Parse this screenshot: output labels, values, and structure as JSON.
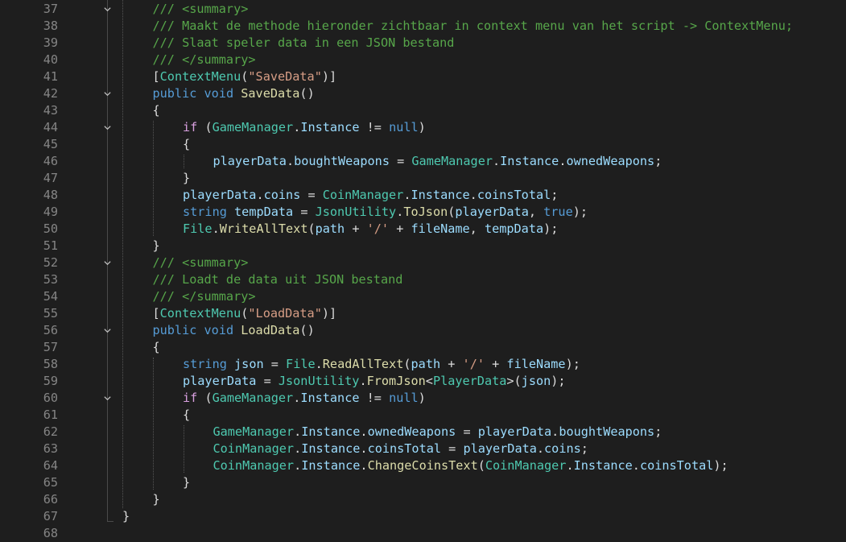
{
  "editor": {
    "fold_icon": "chevron-down-icon",
    "colors": {
      "background": "#1e1e1e",
      "line_number": "#858585",
      "comment": "#57a64a",
      "keyword": "#569cd6",
      "control": "#d8a0df",
      "method": "#dcdcaa",
      "type": "#4ec9b0",
      "string": "#d69d85",
      "variable": "#9cdcfe",
      "text": "#dcdcdc"
    },
    "lines": [
      {
        "n": "37",
        "fold": true,
        "indent": 1,
        "tokens": [
          [
            "comment",
            "/// <summary>"
          ]
        ]
      },
      {
        "n": "38",
        "fold": false,
        "indent": 1,
        "tokens": [
          [
            "comment",
            "/// Maakt de methode hieronder zichtbaar in context menu van het script -> ContextMenu;"
          ]
        ]
      },
      {
        "n": "39",
        "fold": false,
        "indent": 1,
        "tokens": [
          [
            "comment",
            "/// Slaat speler data in een JSON bestand"
          ]
        ]
      },
      {
        "n": "40",
        "fold": false,
        "indent": 1,
        "tokens": [
          [
            "comment",
            "/// </summary>"
          ]
        ]
      },
      {
        "n": "41",
        "fold": false,
        "indent": 1,
        "tokens": [
          [
            "plain",
            "["
          ],
          [
            "type",
            "ContextMenu"
          ],
          [
            "plain",
            "("
          ],
          [
            "string",
            "\"SaveData\""
          ],
          [
            "plain",
            ")]"
          ]
        ]
      },
      {
        "n": "42",
        "fold": true,
        "indent": 1,
        "tokens": [
          [
            "keyword",
            "public"
          ],
          [
            "plain",
            " "
          ],
          [
            "keyword",
            "void"
          ],
          [
            "plain",
            " "
          ],
          [
            "method",
            "SaveData"
          ],
          [
            "plain",
            "()"
          ]
        ]
      },
      {
        "n": "43",
        "fold": false,
        "indent": 1,
        "tokens": [
          [
            "plain",
            "{"
          ]
        ]
      },
      {
        "n": "44",
        "fold": true,
        "indent": 2,
        "tokens": [
          [
            "control",
            "if"
          ],
          [
            "plain",
            " ("
          ],
          [
            "type",
            "GameManager"
          ],
          [
            "plain",
            "."
          ],
          [
            "var",
            "Instance"
          ],
          [
            "plain",
            " != "
          ],
          [
            "keyword",
            "null"
          ],
          [
            "plain",
            ")"
          ]
        ]
      },
      {
        "n": "45",
        "fold": false,
        "indent": 2,
        "tokens": [
          [
            "plain",
            "{"
          ]
        ]
      },
      {
        "n": "46",
        "fold": false,
        "indent": 3,
        "tokens": [
          [
            "var",
            "playerData"
          ],
          [
            "plain",
            "."
          ],
          [
            "var",
            "boughtWeapons"
          ],
          [
            "plain",
            " = "
          ],
          [
            "type",
            "GameManager"
          ],
          [
            "plain",
            "."
          ],
          [
            "var",
            "Instance"
          ],
          [
            "plain",
            "."
          ],
          [
            "var",
            "ownedWeapons"
          ],
          [
            "plain",
            ";"
          ]
        ]
      },
      {
        "n": "47",
        "fold": false,
        "indent": 2,
        "tokens": [
          [
            "plain",
            "}"
          ]
        ]
      },
      {
        "n": "48",
        "fold": false,
        "indent": 2,
        "tokens": [
          [
            "var",
            "playerData"
          ],
          [
            "plain",
            "."
          ],
          [
            "var",
            "coins"
          ],
          [
            "plain",
            " = "
          ],
          [
            "type",
            "CoinManager"
          ],
          [
            "plain",
            "."
          ],
          [
            "var",
            "Instance"
          ],
          [
            "plain",
            "."
          ],
          [
            "var",
            "coinsTotal"
          ],
          [
            "plain",
            ";"
          ]
        ]
      },
      {
        "n": "49",
        "fold": false,
        "indent": 2,
        "tokens": [
          [
            "keyword",
            "string"
          ],
          [
            "plain",
            " "
          ],
          [
            "var",
            "tempData"
          ],
          [
            "plain",
            " = "
          ],
          [
            "type",
            "JsonUtility"
          ],
          [
            "plain",
            "."
          ],
          [
            "method",
            "ToJson"
          ],
          [
            "plain",
            "("
          ],
          [
            "var",
            "playerData"
          ],
          [
            "plain",
            ", "
          ],
          [
            "keyword",
            "true"
          ],
          [
            "plain",
            ");"
          ]
        ]
      },
      {
        "n": "50",
        "fold": false,
        "indent": 2,
        "tokens": [
          [
            "type",
            "File"
          ],
          [
            "plain",
            "."
          ],
          [
            "method",
            "WriteAllText"
          ],
          [
            "plain",
            "("
          ],
          [
            "var",
            "path"
          ],
          [
            "plain",
            " + "
          ],
          [
            "string",
            "'/'"
          ],
          [
            "plain",
            " + "
          ],
          [
            "var",
            "fileName"
          ],
          [
            "plain",
            ", "
          ],
          [
            "var",
            "tempData"
          ],
          [
            "plain",
            ");"
          ]
        ]
      },
      {
        "n": "51",
        "fold": false,
        "indent": 1,
        "tokens": [
          [
            "plain",
            "}"
          ]
        ]
      },
      {
        "n": "52",
        "fold": true,
        "indent": 1,
        "tokens": [
          [
            "comment",
            "/// <summary>"
          ]
        ]
      },
      {
        "n": "53",
        "fold": false,
        "indent": 1,
        "tokens": [
          [
            "comment",
            "/// Loadt de data uit JSON bestand"
          ]
        ]
      },
      {
        "n": "54",
        "fold": false,
        "indent": 1,
        "tokens": [
          [
            "comment",
            "/// </summary>"
          ]
        ]
      },
      {
        "n": "55",
        "fold": false,
        "indent": 1,
        "tokens": [
          [
            "plain",
            "["
          ],
          [
            "type",
            "ContextMenu"
          ],
          [
            "plain",
            "("
          ],
          [
            "string",
            "\"LoadData\""
          ],
          [
            "plain",
            ")]"
          ]
        ]
      },
      {
        "n": "56",
        "fold": true,
        "indent": 1,
        "tokens": [
          [
            "keyword",
            "public"
          ],
          [
            "plain",
            " "
          ],
          [
            "keyword",
            "void"
          ],
          [
            "plain",
            " "
          ],
          [
            "method",
            "LoadData"
          ],
          [
            "plain",
            "()"
          ]
        ]
      },
      {
        "n": "57",
        "fold": false,
        "indent": 1,
        "tokens": [
          [
            "plain",
            "{"
          ]
        ]
      },
      {
        "n": "58",
        "fold": false,
        "indent": 2,
        "tokens": [
          [
            "keyword",
            "string"
          ],
          [
            "plain",
            " "
          ],
          [
            "var",
            "json"
          ],
          [
            "plain",
            " = "
          ],
          [
            "type",
            "File"
          ],
          [
            "plain",
            "."
          ],
          [
            "method",
            "ReadAllText"
          ],
          [
            "plain",
            "("
          ],
          [
            "var",
            "path"
          ],
          [
            "plain",
            " + "
          ],
          [
            "string",
            "'/'"
          ],
          [
            "plain",
            " + "
          ],
          [
            "var",
            "fileName"
          ],
          [
            "plain",
            ");"
          ]
        ]
      },
      {
        "n": "59",
        "fold": false,
        "indent": 2,
        "tokens": [
          [
            "var",
            "playerData"
          ],
          [
            "plain",
            " = "
          ],
          [
            "type",
            "JsonUtility"
          ],
          [
            "plain",
            "."
          ],
          [
            "method",
            "FromJson"
          ],
          [
            "plain",
            "<"
          ],
          [
            "type",
            "PlayerData"
          ],
          [
            "plain",
            ">("
          ],
          [
            "var",
            "json"
          ],
          [
            "plain",
            ");"
          ]
        ]
      },
      {
        "n": "60",
        "fold": true,
        "indent": 2,
        "tokens": [
          [
            "control",
            "if"
          ],
          [
            "plain",
            " ("
          ],
          [
            "type",
            "GameManager"
          ],
          [
            "plain",
            "."
          ],
          [
            "var",
            "Instance"
          ],
          [
            "plain",
            " != "
          ],
          [
            "keyword",
            "null"
          ],
          [
            "plain",
            ")"
          ]
        ]
      },
      {
        "n": "61",
        "fold": false,
        "indent": 2,
        "tokens": [
          [
            "plain",
            "{"
          ]
        ]
      },
      {
        "n": "62",
        "fold": false,
        "indent": 3,
        "tokens": [
          [
            "type",
            "GameManager"
          ],
          [
            "plain",
            "."
          ],
          [
            "var",
            "Instance"
          ],
          [
            "plain",
            "."
          ],
          [
            "var",
            "ownedWeapons"
          ],
          [
            "plain",
            " = "
          ],
          [
            "var",
            "playerData"
          ],
          [
            "plain",
            "."
          ],
          [
            "var",
            "boughtWeapons"
          ],
          [
            "plain",
            ";"
          ]
        ]
      },
      {
        "n": "63",
        "fold": false,
        "indent": 3,
        "tokens": [
          [
            "type",
            "CoinManager"
          ],
          [
            "plain",
            "."
          ],
          [
            "var",
            "Instance"
          ],
          [
            "plain",
            "."
          ],
          [
            "var",
            "coinsTotal"
          ],
          [
            "plain",
            " = "
          ],
          [
            "var",
            "playerData"
          ],
          [
            "plain",
            "."
          ],
          [
            "var",
            "coins"
          ],
          [
            "plain",
            ";"
          ]
        ]
      },
      {
        "n": "64",
        "fold": false,
        "indent": 3,
        "tokens": [
          [
            "type",
            "CoinManager"
          ],
          [
            "plain",
            "."
          ],
          [
            "var",
            "Instance"
          ],
          [
            "plain",
            "."
          ],
          [
            "method",
            "ChangeCoinsText"
          ],
          [
            "plain",
            "("
          ],
          [
            "type",
            "CoinManager"
          ],
          [
            "plain",
            "."
          ],
          [
            "var",
            "Instance"
          ],
          [
            "plain",
            "."
          ],
          [
            "var",
            "coinsTotal"
          ],
          [
            "plain",
            ");"
          ]
        ]
      },
      {
        "n": "65",
        "fold": false,
        "indent": 2,
        "tokens": [
          [
            "plain",
            "}"
          ]
        ]
      },
      {
        "n": "66",
        "fold": false,
        "indent": 1,
        "tokens": [
          [
            "plain",
            "}"
          ]
        ]
      },
      {
        "n": "67",
        "fold": false,
        "indent": 0,
        "tokens": [
          [
            "plain",
            "}"
          ]
        ]
      },
      {
        "n": "68",
        "fold": false,
        "indent": 0,
        "tokens": []
      }
    ]
  }
}
